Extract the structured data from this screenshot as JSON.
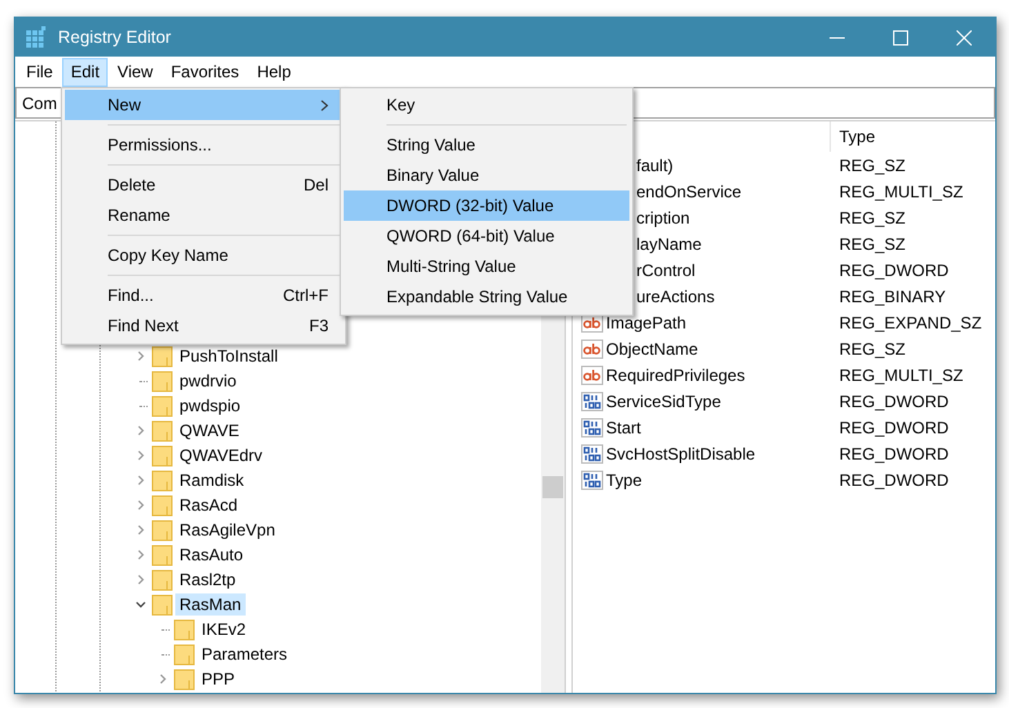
{
  "window": {
    "title": "Registry Editor"
  },
  "menu_bar": [
    {
      "label": "File",
      "selected": false
    },
    {
      "label": "Edit",
      "selected": true
    },
    {
      "label": "View",
      "selected": false
    },
    {
      "label": "Favorites",
      "selected": false
    },
    {
      "label": "Help",
      "selected": false
    }
  ],
  "address_bar": {
    "value": "Com"
  },
  "tree": [
    {
      "name": "PushToInstall",
      "kind": "branch",
      "expanded": false,
      "selected": false
    },
    {
      "name": "pwdrvio",
      "kind": "leaf",
      "selected": false
    },
    {
      "name": "pwdspio",
      "kind": "leaf",
      "selected": false
    },
    {
      "name": "QWAVE",
      "kind": "branch",
      "expanded": false,
      "selected": false
    },
    {
      "name": "QWAVEdrv",
      "kind": "branch",
      "expanded": false,
      "selected": false
    },
    {
      "name": "Ramdisk",
      "kind": "branch",
      "expanded": false,
      "selected": false
    },
    {
      "name": "RasAcd",
      "kind": "branch",
      "expanded": false,
      "selected": false
    },
    {
      "name": "RasAgileVpn",
      "kind": "branch",
      "expanded": false,
      "selected": false
    },
    {
      "name": "RasAuto",
      "kind": "branch",
      "expanded": false,
      "selected": false
    },
    {
      "name": "Rasl2tp",
      "kind": "branch",
      "expanded": false,
      "selected": false
    },
    {
      "name": "RasMan",
      "kind": "branch",
      "expanded": true,
      "selected": true,
      "children": [
        {
          "name": "IKEv2",
          "kind": "leaf",
          "selected": false
        },
        {
          "name": "Parameters",
          "kind": "leaf",
          "selected": false
        },
        {
          "name": "PPP",
          "kind": "branch",
          "expanded": false,
          "selected": false
        }
      ]
    }
  ],
  "values": {
    "columns": [
      {
        "label": "Type"
      }
    ],
    "rows": [
      {
        "name": "fault)",
        "type": "REG_SZ"
      },
      {
        "name": "endOnService",
        "type": "REG_MULTI_SZ"
      },
      {
        "name": "cription",
        "type": "REG_SZ"
      },
      {
        "name": "layName",
        "type": "REG_SZ"
      },
      {
        "name": "rControl",
        "type": "REG_DWORD"
      },
      {
        "name": "ureActions",
        "type": "REG_BINARY"
      },
      {
        "name": "ImagePath",
        "type": "REG_EXPAND_SZ",
        "kind": "string"
      },
      {
        "name": "ObjectName",
        "type": "REG_SZ",
        "kind": "string"
      },
      {
        "name": "RequiredPrivileges",
        "type": "REG_MULTI_SZ",
        "kind": "string"
      },
      {
        "name": "ServiceSidType",
        "type": "REG_DWORD",
        "kind": "binary"
      },
      {
        "name": "Start",
        "type": "REG_DWORD",
        "kind": "binary"
      },
      {
        "name": "SvcHostSplitDisable",
        "type": "REG_DWORD",
        "kind": "binary"
      },
      {
        "name": "Type",
        "type": "REG_DWORD",
        "kind": "binary"
      }
    ]
  },
  "edit_menu": {
    "items": [
      {
        "kind": "item",
        "label": "New",
        "submenu": true,
        "selected": true
      },
      {
        "kind": "separator"
      },
      {
        "kind": "item",
        "label": "Permissions...",
        "selected": false
      },
      {
        "kind": "separator"
      },
      {
        "kind": "item",
        "label": "Delete",
        "shortcut": "Del",
        "selected": false
      },
      {
        "kind": "item",
        "label": "Rename",
        "selected": false
      },
      {
        "kind": "separator"
      },
      {
        "kind": "item",
        "label": "Copy Key Name",
        "selected": false
      },
      {
        "kind": "separator"
      },
      {
        "kind": "item",
        "label": "Find...",
        "shortcut": "Ctrl+F",
        "selected": false
      },
      {
        "kind": "item",
        "label": "Find Next",
        "shortcut": "F3",
        "selected": false
      }
    ]
  },
  "new_submenu": {
    "items": [
      {
        "kind": "item",
        "label": "Key",
        "selected": false
      },
      {
        "kind": "separator"
      },
      {
        "kind": "item",
        "label": "String Value",
        "selected": false
      },
      {
        "kind": "item",
        "label": "Binary Value",
        "selected": false
      },
      {
        "kind": "item",
        "label": "DWORD (32-bit) Value",
        "selected": true
      },
      {
        "kind": "item",
        "label": "QWORD (64-bit) Value",
        "selected": false
      },
      {
        "kind": "item",
        "label": "Multi-String Value",
        "selected": false
      },
      {
        "kind": "item",
        "label": "Expandable String Value",
        "selected": false
      }
    ]
  }
}
